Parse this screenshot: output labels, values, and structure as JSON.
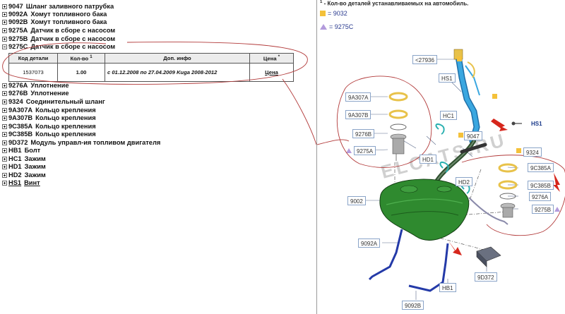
{
  "tree": {
    "items": [
      {
        "code": "9047",
        "name": "Шланг заливного патрубка",
        "state": "plus",
        "link": false
      },
      {
        "code": "9092A",
        "name": "Хомут топливного бака",
        "state": "plus",
        "link": false
      },
      {
        "code": "9092B",
        "name": "Хомут топливного бака",
        "state": "plus",
        "link": false
      },
      {
        "code": "9275A",
        "name": "Датчик в сборе с насосом",
        "state": "plus",
        "link": false
      },
      {
        "code": "9275B",
        "name": "Датчик в сборе с насосом",
        "state": "plus",
        "link": false
      },
      {
        "code": "9275C",
        "name": "Датчик в сборе с насосом",
        "state": "minus",
        "link": false
      },
      {
        "code": "9276A",
        "name": "Уплотнение",
        "state": "plus",
        "link": false
      },
      {
        "code": "9276B",
        "name": "Уплотнение",
        "state": "plus",
        "link": false
      },
      {
        "code": "9324",
        "name": "Соединительный шланг",
        "state": "plus",
        "link": false
      },
      {
        "code": "9A307A",
        "name": "Кольцо крепления",
        "state": "plus",
        "link": false
      },
      {
        "code": "9A307B",
        "name": "Кольцо крепления",
        "state": "plus",
        "link": false
      },
      {
        "code": "9C385A",
        "name": "Кольцо крепления",
        "state": "plus",
        "link": false
      },
      {
        "code": "9C385B",
        "name": "Кольцо крепления",
        "state": "plus",
        "link": false
      },
      {
        "code": "9D372",
        "name": "Модуль управл-ия топливом двигателя",
        "state": "plus",
        "link": false
      },
      {
        "code": "HB1",
        "name": "Болт",
        "state": "plus",
        "link": false
      },
      {
        "code": "HC1",
        "name": "Зажим",
        "state": "plus",
        "link": false
      },
      {
        "code": "HD1",
        "name": "Зажим",
        "state": "plus",
        "link": false
      },
      {
        "code": "HD2",
        "name": "Зажим",
        "state": "plus",
        "link": false
      },
      {
        "code": "HS1",
        "name": "Винт",
        "state": "plus",
        "link": true
      }
    ]
  },
  "table": {
    "headers": {
      "part_code": "Код детали",
      "qty": "Кол-во",
      "qty_note": "1",
      "info": "Доп. инфо",
      "price": "Цена",
      "price_note": "*"
    },
    "row": {
      "part_code": "1537073",
      "qty": "1.00",
      "info": "с 01.12.2008 по 27.04.2009   Kuga 2008-2012",
      "price": "Цена"
    }
  },
  "diagram": {
    "note_sup": "1",
    "note": " - Кол-во деталей устанавливаемых на автомобиль.",
    "legend_square": "= 9032",
    "legend_triangle": "= 9275C",
    "watermark": "ELCATS.RU",
    "callouts": {
      "c27936": "<27936",
      "hs1_top": "HS1",
      "hs1_right": "HS1",
      "hc1": "HC1",
      "c9047": "9047",
      "hd1": "HD1",
      "c9324": "9324",
      "hd2": "HD2",
      "a307a": "9A307A",
      "a307b": "9A307B",
      "c9276b": "9276B",
      "c9275a": "9275A",
      "c385a": "9C385A",
      "c385b": "9C385B",
      "c9276a": "9276A",
      "c9275b": "9275B",
      "c9002": "9002",
      "c9092a": "9092A",
      "c9d372": "9D372",
      "hb1": "HB1",
      "c9092b": "9092B"
    },
    "colors": {
      "tank": "#2f8a2f",
      "hose": "#3aa7e0",
      "clamp": "#243aa8",
      "ring": "#e8c24a",
      "marker": "#f4c13a",
      "triangle": "#b39bdc",
      "annotation": "#c0392b"
    }
  }
}
